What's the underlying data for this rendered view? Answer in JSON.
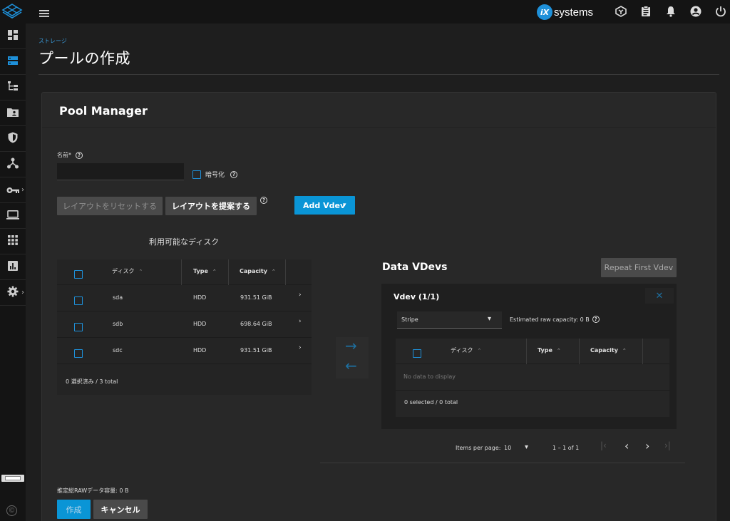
{
  "topbar": {
    "brand_text": "systems",
    "brand_mark": "iX",
    "icons": [
      "menu-icon",
      "truecommand-icon",
      "clipboard-icon",
      "bell-icon",
      "account-icon",
      "power-icon"
    ]
  },
  "sidebar": {
    "items": [
      {
        "name": "dashboard-icon"
      },
      {
        "name": "storage-icon"
      },
      {
        "name": "sharing-tree-icon"
      },
      {
        "name": "folder-user-icon"
      },
      {
        "name": "shield-icon"
      },
      {
        "name": "network-icon"
      },
      {
        "name": "key-icon",
        "chevron": "›"
      },
      {
        "name": "laptop-icon"
      },
      {
        "name": "apps-grid-icon"
      },
      {
        "name": "reporting-icon"
      },
      {
        "name": "gear-icon",
        "chevron": "›"
      }
    ],
    "copyright": "©"
  },
  "page": {
    "breadcrumb": "ストレージ",
    "title": "プールの作成"
  },
  "pool_manager": {
    "title": "Pool Manager",
    "name_label": "名前*",
    "name_value": "",
    "encrypt_label": "暗号化",
    "reset_layout": "レイアウトをリセットする",
    "suggest_layout": "レイアウトを提案する",
    "add_vdev": "Add Vdev",
    "dropdown_caret": "▾",
    "available_title": "利用可能なディスク",
    "columns": {
      "disk": "ディスク",
      "type": "Type",
      "capacity": "Capacity"
    },
    "sort_glyph": "⌃",
    "disks": [
      {
        "name": "sda",
        "type": "HDD",
        "capacity": "931.51 GiB",
        "chevron": "›"
      },
      {
        "name": "sdb",
        "type": "HDD",
        "capacity": "698.64 GiB",
        "chevron": "›"
      },
      {
        "name": "sdc",
        "type": "HDD",
        "capacity": "931.51 GiB",
        "chevron": "›"
      }
    ],
    "available_footer": "0 選択済み / 3 total",
    "arrow_right": "→",
    "arrow_left": "←",
    "data_vdevs_title": "Data VDevs",
    "repeat_first_vdev": "Repeat First Vdev",
    "vdev": {
      "title": "Vdev (1/1)",
      "close": "✕",
      "layout_value": "Stripe",
      "caret": "▾",
      "estimated_raw": "Estimated raw capacity: 0 B",
      "no_data": "No data to display",
      "footer": "0 selected / 0 total"
    },
    "paginator": {
      "items_per_page_label": "Items per page:",
      "items_per_page_value": "10",
      "caret": "▾",
      "range": "1 – 1 of 1",
      "first": "|‹",
      "prev": "‹",
      "next": "›",
      "last": "›|"
    },
    "estimated_total": "推定総RAWデータ容量: 0 B",
    "create": "作成",
    "cancel": "キャンセル"
  },
  "colors": {
    "accent": "#0a95d6",
    "bg": "#1e1e1e",
    "card": "#282828"
  }
}
